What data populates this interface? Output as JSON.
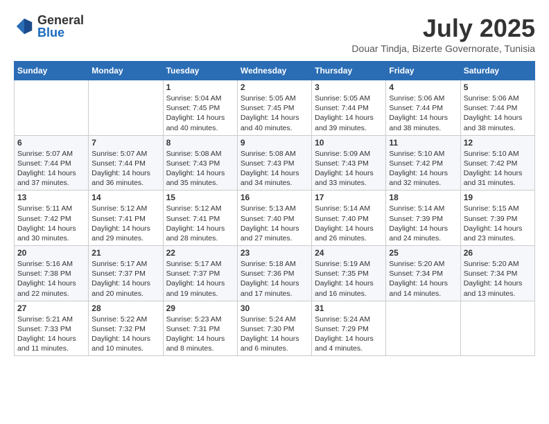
{
  "logo": {
    "general": "General",
    "blue": "Blue"
  },
  "header": {
    "month": "July 2025",
    "subtitle": "Douar Tindja, Bizerte Governorate, Tunisia"
  },
  "weekdays": [
    "Sunday",
    "Monday",
    "Tuesday",
    "Wednesday",
    "Thursday",
    "Friday",
    "Saturday"
  ],
  "weeks": [
    [
      {
        "day": "",
        "info": ""
      },
      {
        "day": "",
        "info": ""
      },
      {
        "day": "1",
        "info": "Sunrise: 5:04 AM\nSunset: 7:45 PM\nDaylight: 14 hours and 40 minutes."
      },
      {
        "day": "2",
        "info": "Sunrise: 5:05 AM\nSunset: 7:45 PM\nDaylight: 14 hours and 40 minutes."
      },
      {
        "day": "3",
        "info": "Sunrise: 5:05 AM\nSunset: 7:44 PM\nDaylight: 14 hours and 39 minutes."
      },
      {
        "day": "4",
        "info": "Sunrise: 5:06 AM\nSunset: 7:44 PM\nDaylight: 14 hours and 38 minutes."
      },
      {
        "day": "5",
        "info": "Sunrise: 5:06 AM\nSunset: 7:44 PM\nDaylight: 14 hours and 38 minutes."
      }
    ],
    [
      {
        "day": "6",
        "info": "Sunrise: 5:07 AM\nSunset: 7:44 PM\nDaylight: 14 hours and 37 minutes."
      },
      {
        "day": "7",
        "info": "Sunrise: 5:07 AM\nSunset: 7:44 PM\nDaylight: 14 hours and 36 minutes."
      },
      {
        "day": "8",
        "info": "Sunrise: 5:08 AM\nSunset: 7:43 PM\nDaylight: 14 hours and 35 minutes."
      },
      {
        "day": "9",
        "info": "Sunrise: 5:08 AM\nSunset: 7:43 PM\nDaylight: 14 hours and 34 minutes."
      },
      {
        "day": "10",
        "info": "Sunrise: 5:09 AM\nSunset: 7:43 PM\nDaylight: 14 hours and 33 minutes."
      },
      {
        "day": "11",
        "info": "Sunrise: 5:10 AM\nSunset: 7:42 PM\nDaylight: 14 hours and 32 minutes."
      },
      {
        "day": "12",
        "info": "Sunrise: 5:10 AM\nSunset: 7:42 PM\nDaylight: 14 hours and 31 minutes."
      }
    ],
    [
      {
        "day": "13",
        "info": "Sunrise: 5:11 AM\nSunset: 7:42 PM\nDaylight: 14 hours and 30 minutes."
      },
      {
        "day": "14",
        "info": "Sunrise: 5:12 AM\nSunset: 7:41 PM\nDaylight: 14 hours and 29 minutes."
      },
      {
        "day": "15",
        "info": "Sunrise: 5:12 AM\nSunset: 7:41 PM\nDaylight: 14 hours and 28 minutes."
      },
      {
        "day": "16",
        "info": "Sunrise: 5:13 AM\nSunset: 7:40 PM\nDaylight: 14 hours and 27 minutes."
      },
      {
        "day": "17",
        "info": "Sunrise: 5:14 AM\nSunset: 7:40 PM\nDaylight: 14 hours and 26 minutes."
      },
      {
        "day": "18",
        "info": "Sunrise: 5:14 AM\nSunset: 7:39 PM\nDaylight: 14 hours and 24 minutes."
      },
      {
        "day": "19",
        "info": "Sunrise: 5:15 AM\nSunset: 7:39 PM\nDaylight: 14 hours and 23 minutes."
      }
    ],
    [
      {
        "day": "20",
        "info": "Sunrise: 5:16 AM\nSunset: 7:38 PM\nDaylight: 14 hours and 22 minutes."
      },
      {
        "day": "21",
        "info": "Sunrise: 5:17 AM\nSunset: 7:37 PM\nDaylight: 14 hours and 20 minutes."
      },
      {
        "day": "22",
        "info": "Sunrise: 5:17 AM\nSunset: 7:37 PM\nDaylight: 14 hours and 19 minutes."
      },
      {
        "day": "23",
        "info": "Sunrise: 5:18 AM\nSunset: 7:36 PM\nDaylight: 14 hours and 17 minutes."
      },
      {
        "day": "24",
        "info": "Sunrise: 5:19 AM\nSunset: 7:35 PM\nDaylight: 14 hours and 16 minutes."
      },
      {
        "day": "25",
        "info": "Sunrise: 5:20 AM\nSunset: 7:34 PM\nDaylight: 14 hours and 14 minutes."
      },
      {
        "day": "26",
        "info": "Sunrise: 5:20 AM\nSunset: 7:34 PM\nDaylight: 14 hours and 13 minutes."
      }
    ],
    [
      {
        "day": "27",
        "info": "Sunrise: 5:21 AM\nSunset: 7:33 PM\nDaylight: 14 hours and 11 minutes."
      },
      {
        "day": "28",
        "info": "Sunrise: 5:22 AM\nSunset: 7:32 PM\nDaylight: 14 hours and 10 minutes."
      },
      {
        "day": "29",
        "info": "Sunrise: 5:23 AM\nSunset: 7:31 PM\nDaylight: 14 hours and 8 minutes."
      },
      {
        "day": "30",
        "info": "Sunrise: 5:24 AM\nSunset: 7:30 PM\nDaylight: 14 hours and 6 minutes."
      },
      {
        "day": "31",
        "info": "Sunrise: 5:24 AM\nSunset: 7:29 PM\nDaylight: 14 hours and 4 minutes."
      },
      {
        "day": "",
        "info": ""
      },
      {
        "day": "",
        "info": ""
      }
    ]
  ]
}
